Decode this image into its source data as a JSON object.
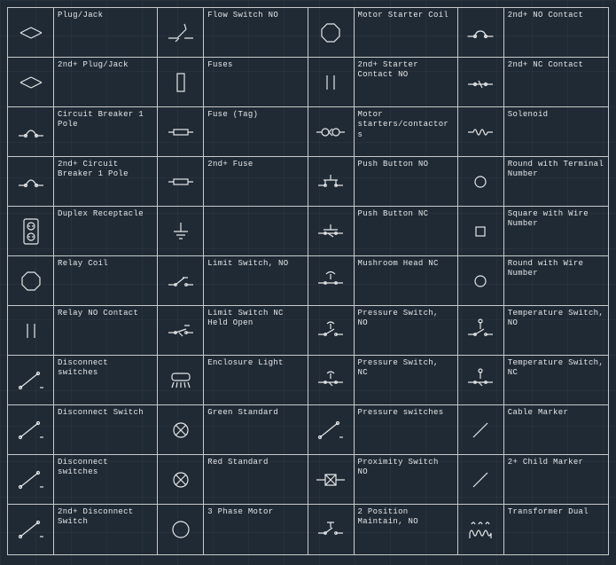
{
  "palette": {
    "columns": 4,
    "items": [
      {
        "label": "Plug/Jack",
        "icon": "plug"
      },
      {
        "label": "Flow Switch NO",
        "icon": "flow-switch"
      },
      {
        "label": "Motor Starter Coil",
        "icon": "coil-octagon"
      },
      {
        "label": "2nd+ NO Contact",
        "icon": "no-contact"
      },
      {
        "label": "2nd+ Plug/Jack",
        "icon": "plug"
      },
      {
        "label": "Fuses",
        "icon": "fuse-rect"
      },
      {
        "label": "2nd+ Starter Contact NO",
        "icon": "contact-parallel"
      },
      {
        "label": "2nd+ NC Contact",
        "icon": "nc-contact"
      },
      {
        "label": "Circuit Breaker 1 Pole",
        "icon": "breaker"
      },
      {
        "label": "Fuse (Tag)",
        "icon": "fuse-bar"
      },
      {
        "label": "Motor starters/contactors",
        "icon": "starter-contactor"
      },
      {
        "label": "Solenoid",
        "icon": "solenoid"
      },
      {
        "label": "2nd+ Circuit Breaker 1 Pole",
        "icon": "breaker"
      },
      {
        "label": "2nd+ Fuse",
        "icon": "fuse-bar"
      },
      {
        "label": "Push Button NO",
        "icon": "pushbutton-no"
      },
      {
        "label": "Round with Terminal Number",
        "icon": "circle"
      },
      {
        "label": "Duplex Receptacle",
        "icon": "duplex"
      },
      {
        "label": "",
        "icon": "ground"
      },
      {
        "label": "Push Button NC",
        "icon": "pushbutton-nc"
      },
      {
        "label": "Square with Wire Number",
        "icon": "square"
      },
      {
        "label": "Relay Coil",
        "icon": "coil-octagon"
      },
      {
        "label": "Limit Switch, NO",
        "icon": "limit-no"
      },
      {
        "label": "Mushroom Head NC",
        "icon": "mushroom-nc"
      },
      {
        "label": "Round with Wire Number",
        "icon": "circle"
      },
      {
        "label": "Relay NO Contact",
        "icon": "contact-parallel"
      },
      {
        "label": "Limit Switch NC Held Open",
        "icon": "limit-nc-held"
      },
      {
        "label": "Pressure Switch, NO",
        "icon": "pressure-no"
      },
      {
        "label": "Temperature Switch, NO",
        "icon": "temp-no"
      },
      {
        "label": "Disconnect switches",
        "icon": "disconnect"
      },
      {
        "label": "Enclosure Light",
        "icon": "enclosure-light"
      },
      {
        "label": "Pressure Switch, NC",
        "icon": "pressure-nc"
      },
      {
        "label": "Temperature Switch, NC",
        "icon": "temp-nc"
      },
      {
        "label": "Disconnect Switch",
        "icon": "disconnect"
      },
      {
        "label": "Green Standard",
        "icon": "lamp"
      },
      {
        "label": "Pressure switches",
        "icon": "disconnect"
      },
      {
        "label": "Cable Marker",
        "icon": "marker"
      },
      {
        "label": "Disconnect switches",
        "icon": "disconnect"
      },
      {
        "label": "Red Standard",
        "icon": "lamp"
      },
      {
        "label": "Proximity Switch NO",
        "icon": "proximity"
      },
      {
        "label": "2+ Child Marker",
        "icon": "marker"
      },
      {
        "label": "2nd+ Disconnect Switch",
        "icon": "disconnect"
      },
      {
        "label": "3 Phase Motor",
        "icon": "motor"
      },
      {
        "label": "2 Position Maintain, NO",
        "icon": "selector-2pos"
      },
      {
        "label": "Transformer Dual",
        "icon": "transformer"
      }
    ]
  }
}
